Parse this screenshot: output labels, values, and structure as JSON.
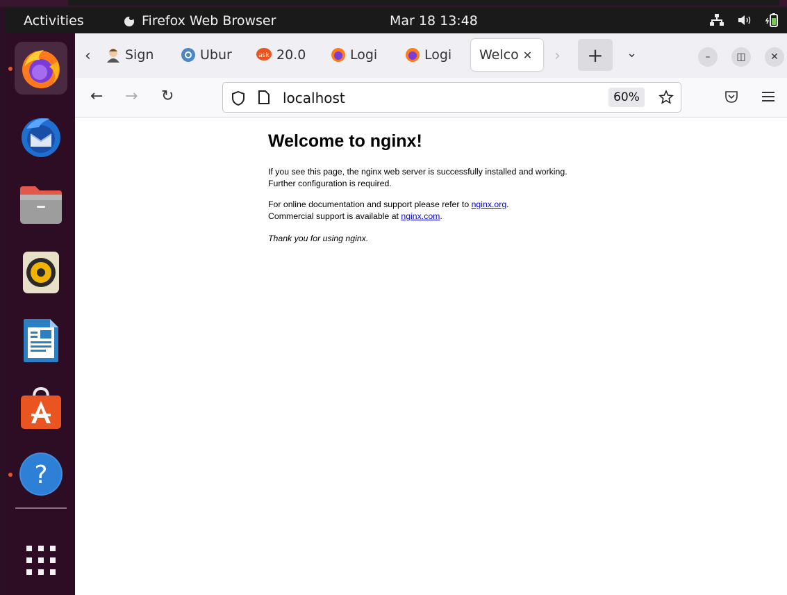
{
  "topbar": {
    "activities": "Activities",
    "app_name": "Firefox Web Browser",
    "clock": "Mar 18  13:48",
    "tray_icons": [
      "network-icon",
      "volume-icon",
      "battery-icon"
    ]
  },
  "dock": {
    "items": [
      "firefox-icon",
      "thunderbird-icon",
      "files-icon",
      "rhythmbox-icon",
      "libreoffice-writer-icon",
      "software-center-icon",
      "help-icon",
      "app-grid-icon"
    ]
  },
  "tabs": [
    {
      "label": "Sign",
      "icon": "user-avatar-icon"
    },
    {
      "label": "Ubur",
      "icon": "ubuntu-icon"
    },
    {
      "label": "20.0",
      "icon": "askubuntu-icon"
    },
    {
      "label": "Logi",
      "icon": "firefox-icon"
    },
    {
      "label": "Logi",
      "icon": "firefox-icon"
    },
    {
      "label": "Welco",
      "icon": "",
      "active": true
    }
  ],
  "navbar": {
    "url": "localhost",
    "zoom": "60%"
  },
  "page": {
    "title": "Welcome to nginx!",
    "p1": "If you see this page, the nginx web server is successfully installed and working. Further configuration is required.",
    "p2_pre": "For online documentation and support please refer to ",
    "p2_link1": "nginx.org",
    "p2_mid": ".",
    "p2_line2": "Commercial support is available at ",
    "p2_link2": "nginx.com",
    "p2_end": ".",
    "p3": "Thank you for using nginx."
  },
  "colors": {
    "accent": "#e95420",
    "dock_bg": "#2c0d24",
    "link": "#0000ee"
  }
}
